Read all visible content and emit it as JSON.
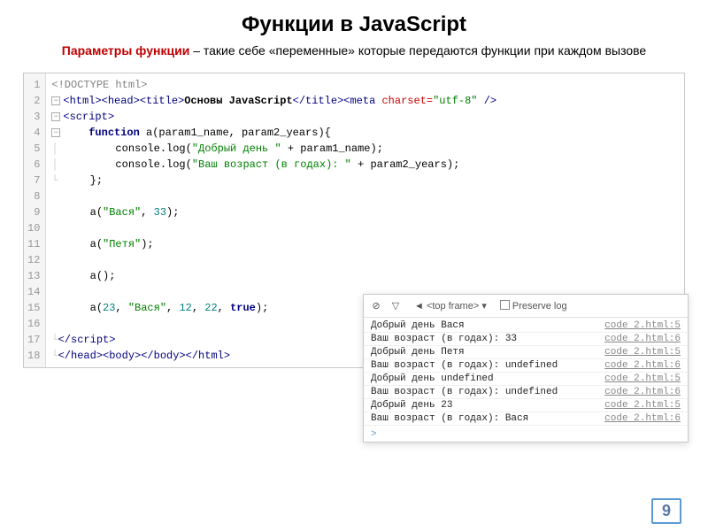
{
  "title": "Функции в JavaScript",
  "subtitle_term": "Параметры функции",
  "subtitle_rest": " – такие себе «переменные» которые передаются функции при каждом вызове",
  "page_number": "9",
  "code_lines": [
    {
      "n": "1",
      "html": "<span class='c-gray'>&lt;!DOCTYPE html&gt;</span>"
    },
    {
      "n": "2",
      "html": "<span class='fold'></span><span class='c-navy'>&lt;html&gt;&lt;head&gt;&lt;title&gt;</span><span class='c-bold'>Основы JavaScript</span><span class='c-navy'>&lt;/title&gt;&lt;meta </span><span class='c-red'>charset=</span><span class='c-green'>\"utf-8\"</span><span class='c-navy'> /&gt;</span>"
    },
    {
      "n": "3",
      "html": "<span class='fold'></span><span class='c-navy'>&lt;script&gt;</span>"
    },
    {
      "n": "4",
      "html": "<span class='fold'></span>    <span class='c-navy c-bold'>function</span> a(param1_name, param2_years){"
    },
    {
      "n": "5",
      "html": "<span class='fold-line'>│</span>         console.log(<span class='c-str'>\"Добрый день \"</span> + param1_name);"
    },
    {
      "n": "6",
      "html": "<span class='fold-line'>│</span>         console.log(<span class='c-str'>\"Ваш возраст (в годах): \"</span> + param2_years);"
    },
    {
      "n": "7",
      "html": "<span class='fold-line'>└</span>     };"
    },
    {
      "n": "8",
      "html": ""
    },
    {
      "n": "9",
      "html": "      a(<span class='c-str'>\"Вася\"</span>, <span class='c-teal'>33</span>);"
    },
    {
      "n": "10",
      "html": ""
    },
    {
      "n": "11",
      "html": "      a(<span class='c-str'>\"Петя\"</span>);"
    },
    {
      "n": "12",
      "html": ""
    },
    {
      "n": "13",
      "html": "      a();"
    },
    {
      "n": "14",
      "html": ""
    },
    {
      "n": "15",
      "html": "      a(<span class='c-teal'>23</span>, <span class='c-str'>\"Вася\"</span>, <span class='c-teal'>12</span>, <span class='c-teal'>22</span>, <span class='c-navy c-bold'>true</span>);"
    },
    {
      "n": "16",
      "html": ""
    },
    {
      "n": "17",
      "html": "<span class='fold-line'>└</span><span class='c-navy'>&lt;/script&gt;</span>"
    },
    {
      "n": "18",
      "html": "<span class='fold-line'>└</span><span class='c-navy'>&lt;/head&gt;&lt;body&gt;&lt;/body&gt;&lt;/html&gt;</span>"
    }
  ],
  "console": {
    "frame_label": "<top frame>",
    "preserve_label": "Preserve log",
    "rows": [
      {
        "msg": "Добрый день Вася",
        "src": "code 2.html:5"
      },
      {
        "msg": "Ваш возраст (в годах): 33",
        "src": "code 2.html:6"
      },
      {
        "msg": "Добрый день Петя",
        "src": "code 2.html:5"
      },
      {
        "msg": "Ваш возраст (в годах): undefined",
        "src": "code 2.html:6"
      },
      {
        "msg": "Добрый день undefined",
        "src": "code 2.html:5"
      },
      {
        "msg": "Ваш возраст (в годах): undefined",
        "src": "code 2.html:6"
      },
      {
        "msg": "Добрый день 23",
        "src": "code 2.html:5"
      },
      {
        "msg": "Ваш возраст (в годах): Вася",
        "src": "code 2.html:6"
      }
    ],
    "prompt": ">"
  }
}
